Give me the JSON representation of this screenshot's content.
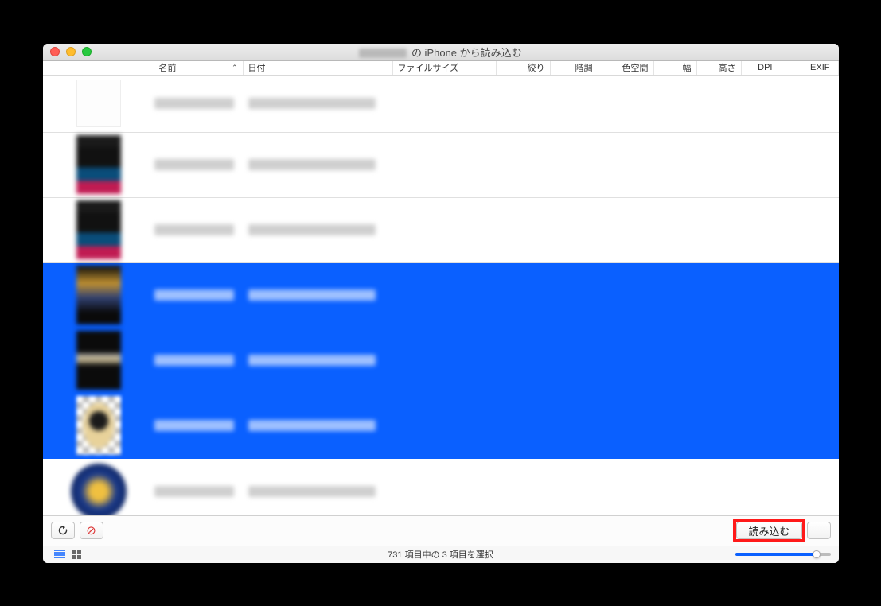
{
  "title": {
    "suffix": " の iPhone から読み込む"
  },
  "columns": {
    "name": "名前",
    "date": "日付",
    "filesize": "ファイルサイズ",
    "aperture": "絞り",
    "depth": "階調",
    "colorspace": "色空間",
    "width": "幅",
    "height": "高さ",
    "dpi": "DPI",
    "exif": "EXIF"
  },
  "rows": [
    {
      "selected": false,
      "thumb": "blank"
    },
    {
      "selected": false,
      "thumb": "a"
    },
    {
      "selected": false,
      "thumb": "a"
    },
    {
      "selected": true,
      "thumb": "sel1"
    },
    {
      "selected": true,
      "thumb": "c"
    },
    {
      "selected": true,
      "thumb": "d"
    },
    {
      "selected": false,
      "thumb": "e"
    }
  ],
  "toolbar": {
    "import_label": "読み込む"
  },
  "status": {
    "text": "731 項目中の 3 項目を選択",
    "total": 731,
    "selected": 3,
    "zoom_percent": 85
  }
}
